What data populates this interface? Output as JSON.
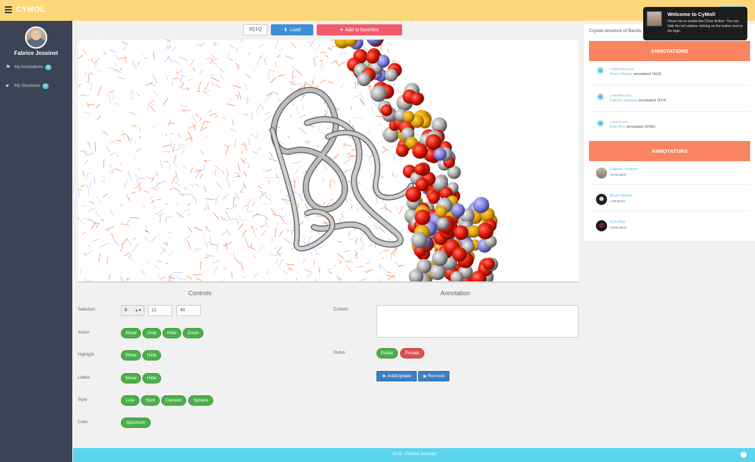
{
  "app": {
    "brand": "CYMOL"
  },
  "user": {
    "name": "Fabrice Jossinet"
  },
  "sidebar": {
    "items": [
      {
        "label": "My Annotations",
        "badge": "4"
      },
      {
        "label": "My Structures",
        "badge": "3"
      }
    ]
  },
  "toolbar": {
    "pdb_id": "3Q1Q",
    "load_label": "Load",
    "favorites_label": "Add to favorites"
  },
  "controls": {
    "title": "Controls",
    "selection": {
      "label": "Selection",
      "chain": "B",
      "start": "12",
      "end": "40"
    },
    "action": {
      "label": "Action",
      "buttons": [
        "Show",
        "Only",
        "Hide",
        "Zoom"
      ]
    },
    "highlight": {
      "label": "Highlight",
      "buttons": [
        "Show",
        "Hide"
      ]
    },
    "labels": {
      "label": "Labels",
      "buttons": [
        "Show",
        "Hide"
      ]
    },
    "style": {
      "label": "Style",
      "buttons": [
        "Line",
        "Stick",
        "Cartoon",
        "Sphere"
      ]
    },
    "color": {
      "label": "Color",
      "buttons": [
        "Spectrum"
      ]
    }
  },
  "annotation": {
    "title": "Annotation",
    "content_label": "Content",
    "status_label": "Status",
    "public_label": "Public",
    "private_label": "Private",
    "add_label": "Add/Update",
    "remove_label": "Remove"
  },
  "right_panel": {
    "structure_title": "Crystal structure of Bacillu",
    "annotations_header": "ANNOTATIONS",
    "timeline": [
      {
        "time": "2 MINUTES AGO",
        "user": "Bruce Wayne",
        "text": " annotated 1EHZ."
      },
      {
        "time": "3 HOURS AGO",
        "user": "Fabrice Jossinet",
        "text": " annotated 1FFK."
      },
      {
        "time": "2 DAYS AGO",
        "user": "Kylo Ren",
        "text": " annotated 4ONO."
      }
    ],
    "annotators_header": "ANNOTATORS",
    "annotators": [
      {
        "name": "Fabrice Jossinet",
        "status": "AVAILABLE"
      },
      {
        "name": "Bruce Wayne",
        "status": "I AM BUSY"
      },
      {
        "name": "Kylo Ren",
        "status": "AVAILABLE"
      }
    ]
  },
  "tooltip": {
    "title": "Welcome to CyMol!",
    "body": "Hover me to enable the Close Button. You can hide the left sidebar clicking on the button next to the logo."
  },
  "footer": {
    "text": "2015 - Fabrice Jossinet"
  },
  "colors": {
    "topbar": "#fdd77a",
    "sidebar": "#3b4355",
    "accent": "#5bc5de",
    "orange": "#fa8460",
    "green": "#4cae4c",
    "red": "#d9534f",
    "blue": "#3b7fc0"
  },
  "icons": [
    "menu-icon",
    "tag-icon",
    "heart-icon",
    "download-icon",
    "clock-icon",
    "arrow-up-icon"
  ]
}
